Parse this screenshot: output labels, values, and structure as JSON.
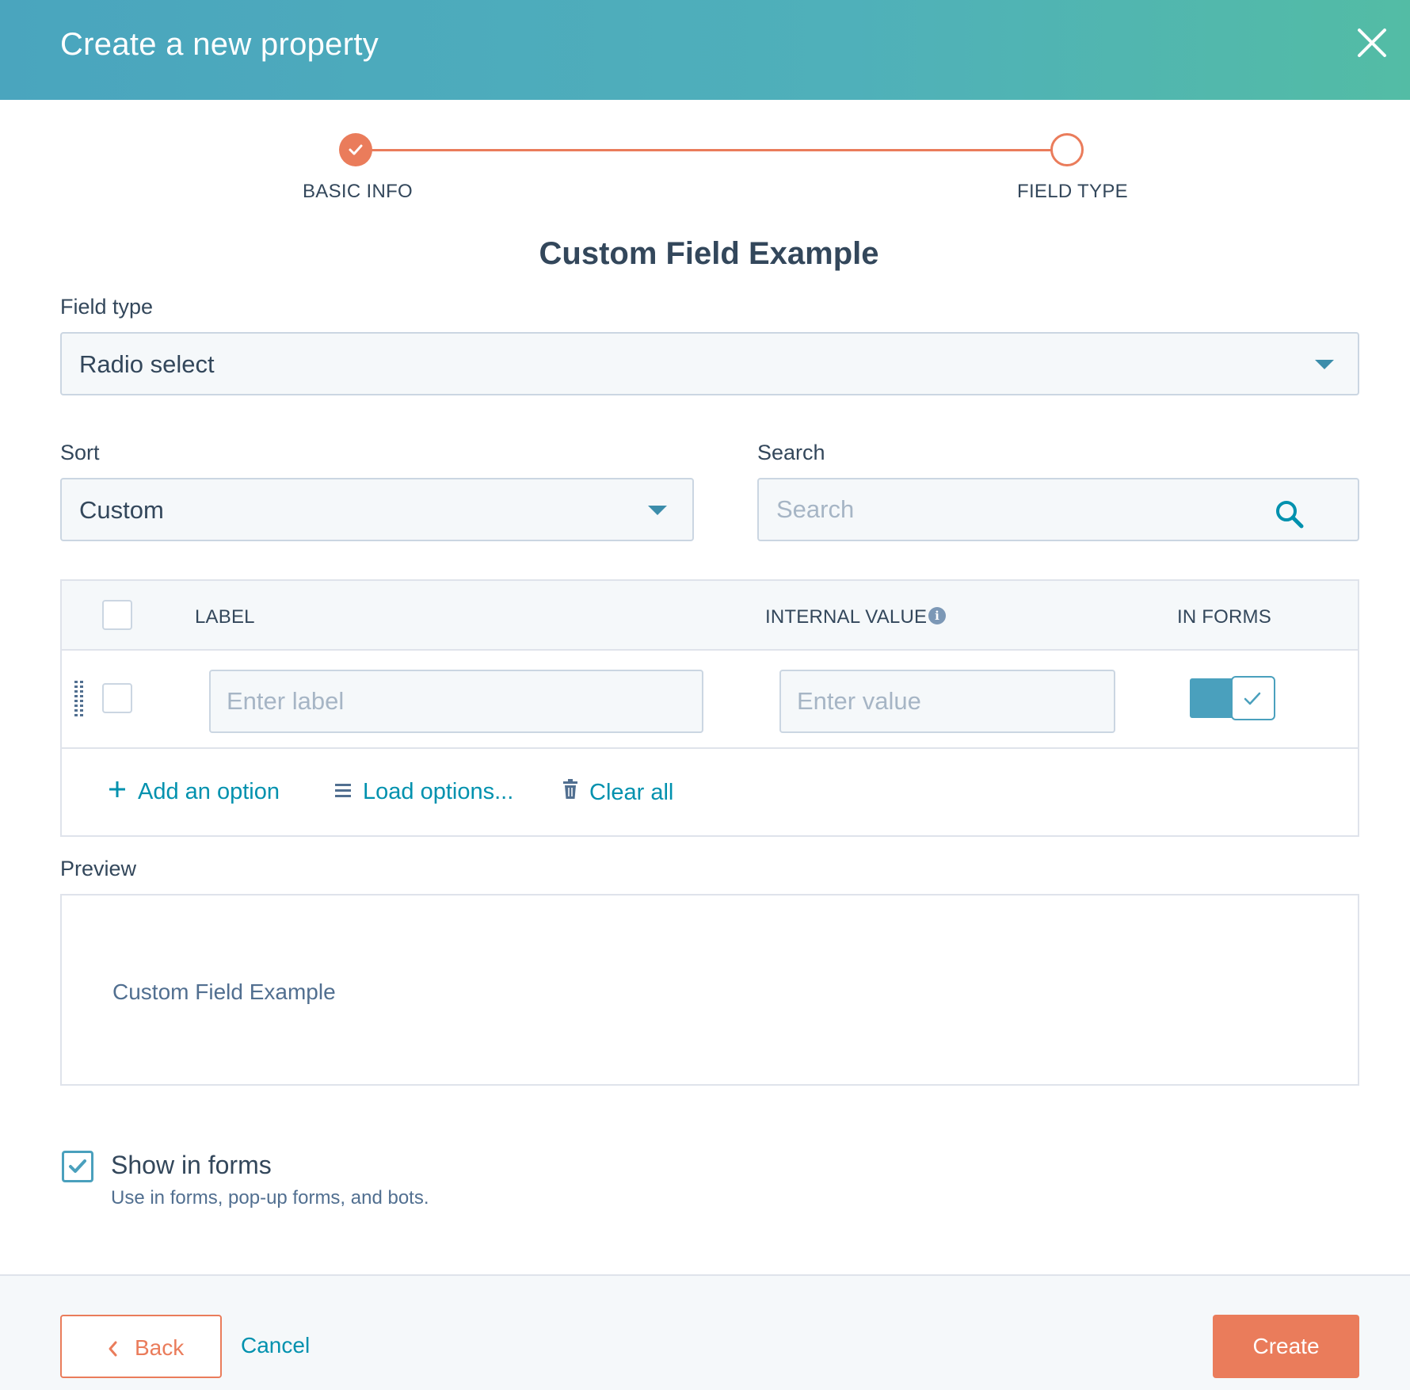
{
  "header": {
    "title": "Create a new property",
    "close_icon": "close-icon"
  },
  "stepper": {
    "steps": [
      {
        "label": "BASIC INFO",
        "state": "complete"
      },
      {
        "label": "FIELD TYPE",
        "state": "current"
      }
    ]
  },
  "section_title": "Custom Field Example",
  "field_type": {
    "label": "Field type",
    "value": "Radio select"
  },
  "sort": {
    "label": "Sort",
    "value": "Custom"
  },
  "search": {
    "label": "Search",
    "placeholder": "Search"
  },
  "options_table": {
    "headers": {
      "label": "LABEL",
      "internal_value": "INTERNAL VALUE",
      "in_forms": "IN FORMS"
    },
    "rows": [
      {
        "label_placeholder": "Enter label",
        "value_placeholder": "Enter value",
        "in_forms": true
      }
    ],
    "actions": {
      "add": "Add an option",
      "load": "Load options...",
      "clear": "Clear all"
    }
  },
  "preview": {
    "label": "Preview",
    "text": "Custom Field Example"
  },
  "show_in_forms": {
    "label": "Show in forms",
    "help": "Use in forms, pop-up forms, and bots.",
    "checked": true
  },
  "footer": {
    "back_label": "Back",
    "cancel_label": "Cancel",
    "create_label": "Create"
  },
  "colors": {
    "accent": "#ea7c5b",
    "link": "#0091ae",
    "toggle": "#4aa0bd",
    "header_gradient_start": "#4aa5be",
    "header_gradient_end": "#53bca5"
  }
}
